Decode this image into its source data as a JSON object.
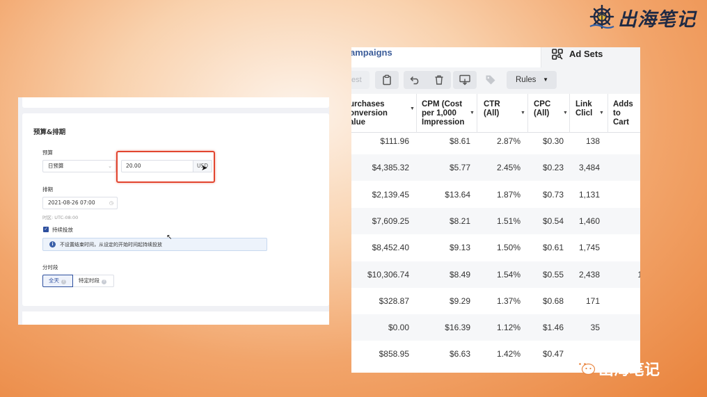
{
  "logo": {
    "brand_name": "出海笔记",
    "icon": "anchor-ship-wheel-icon"
  },
  "watermark": {
    "text": "出海笔记",
    "icon": "wechat-icon"
  },
  "budget_form": {
    "section_title": "预算&排期",
    "budget": {
      "label": "预算",
      "type_value": "日预算",
      "amount_value": "20.00",
      "currency": "USD"
    },
    "schedule": {
      "label": "排期",
      "start_value": "2021-08-26 07:00",
      "timezone": "时区: UTC-08:00"
    },
    "continuous": {
      "label": "持续投放",
      "checked": true,
      "notice": "不设置结束时间，从设定的开始时间起持续投放"
    },
    "dayparting": {
      "label": "分时段",
      "options": [
        "全天",
        "特定时段"
      ],
      "selected": "全天"
    }
  },
  "ads_manager": {
    "tabs": {
      "campaigns": "ampaigns",
      "ad_sets": "Ad Sets"
    },
    "toolbar": {
      "test_label": "est",
      "icons": [
        "clipboard-icon",
        "undo-icon",
        "trash-icon",
        "export-icon",
        "tag-icon"
      ],
      "rules_label": "Rules"
    },
    "columns": [
      [
        "urchases",
        "onversion",
        "alue"
      ],
      [
        "CPM (Cost",
        "per 1,000",
        "Impression"
      ],
      [
        "CTR",
        "(All)"
      ],
      [
        "CPC",
        "(All)"
      ],
      [
        "Link",
        "Clicl"
      ],
      [
        "Adds to",
        "Cart"
      ]
    ],
    "rows": [
      {
        "purchases_value": "$111.96",
        "cpm": "$8.61",
        "ctr": "2.87%",
        "cpc": "$0.30",
        "link_clicks": "138",
        "adds_to_cart": ""
      },
      {
        "purchases_value": "$4,385.32",
        "cpm": "$5.77",
        "ctr": "2.45%",
        "cpc": "$0.23",
        "link_clicks": "3,484",
        "adds_to_cart": ""
      },
      {
        "purchases_value": "$2,139.45",
        "cpm": "$13.64",
        "ctr": "1.87%",
        "cpc": "$0.73",
        "link_clicks": "1,131",
        "adds_to_cart": ""
      },
      {
        "purchases_value": "$7,609.25",
        "cpm": "$8.21",
        "ctr": "1.51%",
        "cpc": "$0.54",
        "link_clicks": "1,460",
        "adds_to_cart": ""
      },
      {
        "purchases_value": "$8,452.40",
        "cpm": "$9.13",
        "ctr": "1.50%",
        "cpc": "$0.61",
        "link_clicks": "1,745",
        "adds_to_cart": ""
      },
      {
        "purchases_value": "$10,306.74",
        "cpm": "$8.49",
        "ctr": "1.54%",
        "cpc": "$0.55",
        "link_clicks": "2,438",
        "adds_to_cart": "1"
      },
      {
        "purchases_value": "$328.87",
        "cpm": "$9.29",
        "ctr": "1.37%",
        "cpc": "$0.68",
        "link_clicks": "171",
        "adds_to_cart": ""
      },
      {
        "purchases_value": "$0.00",
        "cpm": "$16.39",
        "ctr": "1.12%",
        "cpc": "$1.46",
        "link_clicks": "35",
        "adds_to_cart": ""
      },
      {
        "purchases_value": "$858.95",
        "cpm": "$6.63",
        "ctr": "1.42%",
        "cpc": "$0.47",
        "link_clicks": "",
        "adds_to_cart": ""
      }
    ]
  }
}
